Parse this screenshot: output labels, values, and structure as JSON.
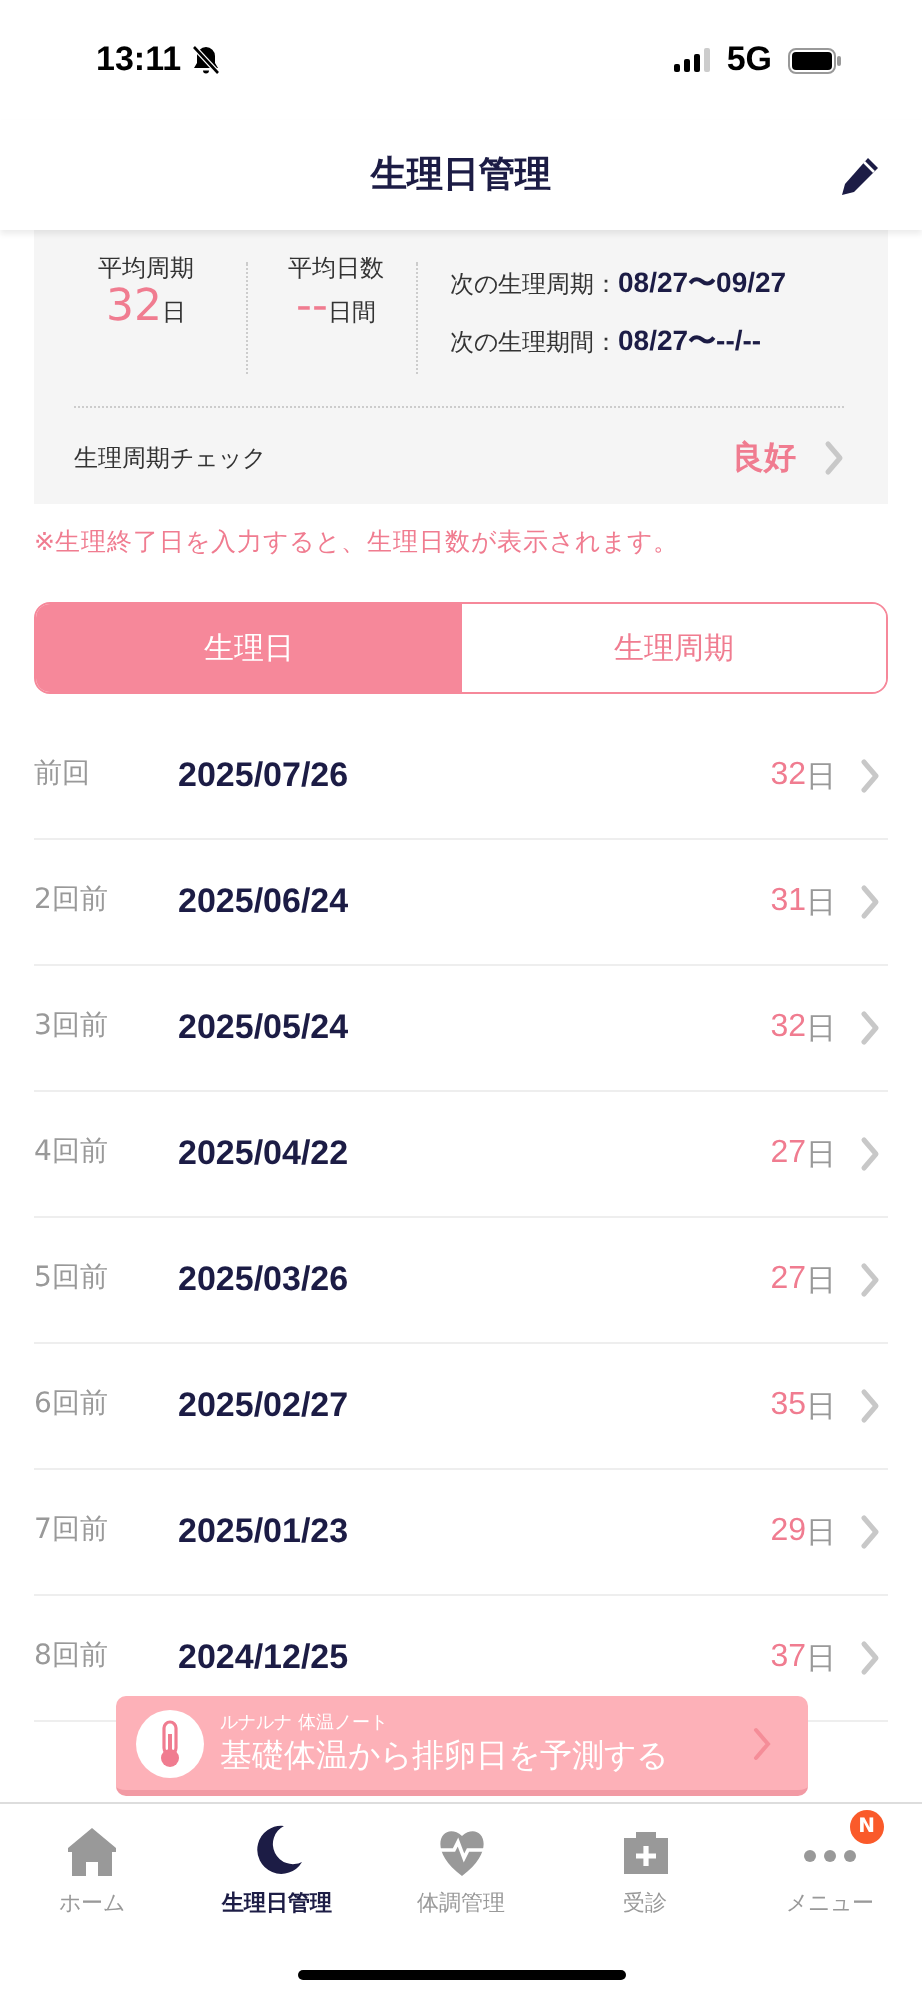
{
  "status_bar": {
    "time": "13:11",
    "network": "5G"
  },
  "header": {
    "title": "生理日管理"
  },
  "summary": {
    "avg_cycle": {
      "label": "平均周期",
      "value": "32",
      "unit": "日"
    },
    "avg_days": {
      "label": "平均日数",
      "value": "--",
      "unit": "日間"
    },
    "next": [
      {
        "label": "次の生理周期：",
        "value": "08/27〜09/27"
      },
      {
        "label": "次の生理期間：",
        "value": "08/27〜--/--"
      }
    ],
    "check": {
      "label": "生理周期チェック",
      "value": "良好"
    }
  },
  "note": "※生理終了日を入力すると、生理日数が表示されます。",
  "segments": [
    {
      "label": "生理日",
      "selected": true
    },
    {
      "label": "生理周期",
      "selected": false
    }
  ],
  "rows": [
    {
      "label": "前回",
      "date": "2025/07/26",
      "days": "32",
      "unit": "日"
    },
    {
      "label": "2回前",
      "date": "2025/06/24",
      "days": "31",
      "unit": "日"
    },
    {
      "label": "3回前",
      "date": "2025/05/24",
      "days": "32",
      "unit": "日"
    },
    {
      "label": "4回前",
      "date": "2025/04/22",
      "days": "27",
      "unit": "日"
    },
    {
      "label": "5回前",
      "date": "2025/03/26",
      "days": "27",
      "unit": "日"
    },
    {
      "label": "6回前",
      "date": "2025/02/27",
      "days": "35",
      "unit": "日"
    },
    {
      "label": "7回前",
      "date": "2025/01/23",
      "days": "29",
      "unit": "日"
    },
    {
      "label": "8回前",
      "date": "2024/12/25",
      "days": "37",
      "unit": "日"
    }
  ],
  "banner": {
    "subtitle": "ルナルナ 体温ノート",
    "title": "基礎体温から排卵日を予測する"
  },
  "tabbar": [
    {
      "kind": "home",
      "label": "ホーム",
      "selected": false
    },
    {
      "kind": "moon",
      "label": "生理日管理",
      "selected": true
    },
    {
      "kind": "heart",
      "label": "体調管理",
      "selected": false
    },
    {
      "kind": "clinic",
      "label": "受診",
      "selected": false
    },
    {
      "kind": "menu",
      "label": "メニュー",
      "selected": false,
      "badge": "N"
    }
  ]
}
